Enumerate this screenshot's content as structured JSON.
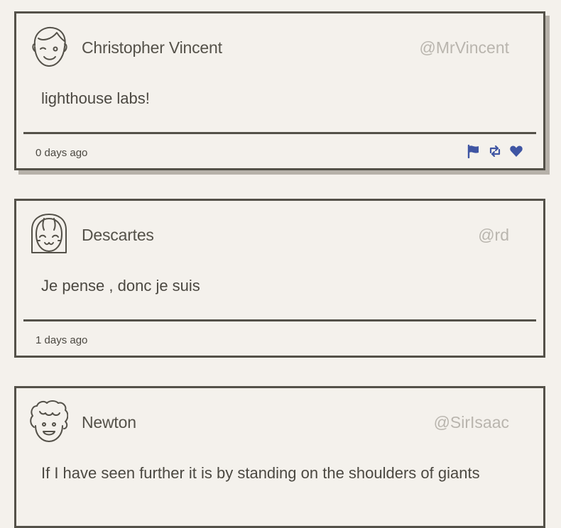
{
  "colors": {
    "border": "#545149",
    "handle": "#b9b5ae",
    "icon_accent": "#3f55a3",
    "background": "#f4f1ec"
  },
  "tweets": [
    {
      "avatar": "winking-face-avatar-icon",
      "name": "Christopher Vincent",
      "handle": "@MrVincent",
      "content": "lighthouse labs!",
      "timestamp": "0 days ago",
      "actions": [
        "flag-icon",
        "retweet-icon",
        "heart-icon"
      ]
    },
    {
      "avatar": "bangs-girl-avatar-icon",
      "name": "Descartes",
      "handle": "@rd",
      "content": "Je pense , donc je suis",
      "timestamp": "1 days ago"
    },
    {
      "avatar": "curly-hair-avatar-icon",
      "name": "Newton",
      "handle": "@SirIsaac",
      "content": "If I have seen further it is by standing on the shoulders of giants"
    }
  ]
}
